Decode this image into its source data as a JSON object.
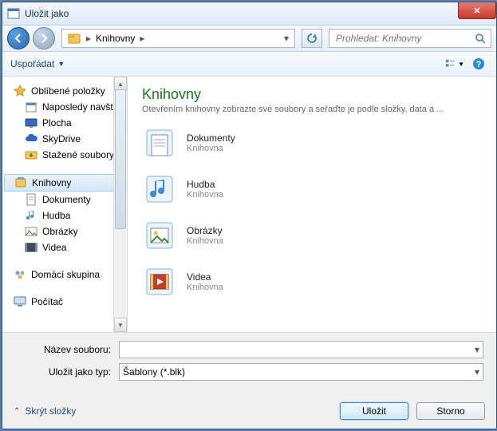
{
  "title": "Uložit jako",
  "nav": {
    "breadcrumb_root": "Knihovny"
  },
  "search": {
    "placeholder": "Prohledat: Knihovny"
  },
  "toolbar": {
    "organize": "Uspořádat"
  },
  "sidebar": {
    "favorites": {
      "label": "Oblíbené položky",
      "items": [
        "Naposledy navští",
        "Plocha",
        "SkyDrive",
        "Stažené soubory"
      ]
    },
    "libraries": {
      "label": "Knihovny",
      "items": [
        "Dokumenty",
        "Hudba",
        "Obrázky",
        "Videa"
      ]
    },
    "homegroup": {
      "label": "Domácí skupina"
    },
    "computer": {
      "label": "Počítač"
    }
  },
  "main": {
    "heading": "Knihovny",
    "subtitle": "Otevřením knihovny zobrazte své soubory a seřaďte je podle složky, data a ...",
    "items": [
      {
        "name": "Dokumenty",
        "type": "Knihovna"
      },
      {
        "name": "Hudba",
        "type": "Knihovna"
      },
      {
        "name": "Obrázky",
        "type": "Knihovna"
      },
      {
        "name": "Videa",
        "type": "Knihovna"
      }
    ]
  },
  "form": {
    "filename_label": "Název souboru:",
    "filename_value": "",
    "filetype_label": "Uložit jako typ:",
    "filetype_value": "Šablony (*.blk)"
  },
  "footer": {
    "hide_folders": "Skrýt složky",
    "save": "Uložit",
    "cancel": "Storno"
  }
}
